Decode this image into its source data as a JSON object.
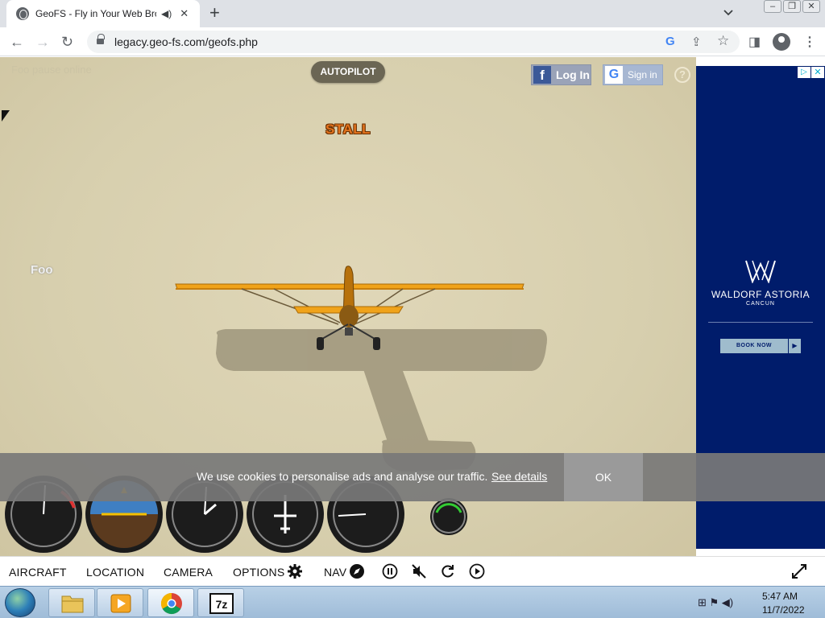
{
  "browser": {
    "tab_title": "GeoFS - Fly in Your Web Bro",
    "url": "legacy.geo-fs.com/geofs.php",
    "new_tab_label": "+",
    "tab_close": "✕"
  },
  "game": {
    "faded_label": "Foo pause online",
    "autopilot_label": "AUTOPILOT",
    "stall_label": "STALL",
    "facebook_label": "Log In",
    "google_label": "Sign in",
    "help_label": "?",
    "player_name": "Foo",
    "gauges": [
      "airspeed",
      "attitude",
      "altimeter",
      "heading",
      "vertical-speed",
      "rpm"
    ]
  },
  "cookie_banner": {
    "message": "We use cookies to personalise ads and analyse our traffic.",
    "link": "See details",
    "ok": "OK"
  },
  "ad": {
    "brand": "WALDORF ASTORIA",
    "location": "CANCUN",
    "cta": "BOOK NOW",
    "bg_color": "#001c6b"
  },
  "menu": {
    "aircraft": "AIRCRAFT",
    "location": "LOCATION",
    "camera": "CAMERA",
    "options": "OPTIONS",
    "nav": "NAV"
  },
  "taskbar": {
    "time": "5:47 AM",
    "date": "11/7/2022",
    "apps": [
      "file-explorer",
      "media-player",
      "chrome",
      "7zip"
    ]
  }
}
